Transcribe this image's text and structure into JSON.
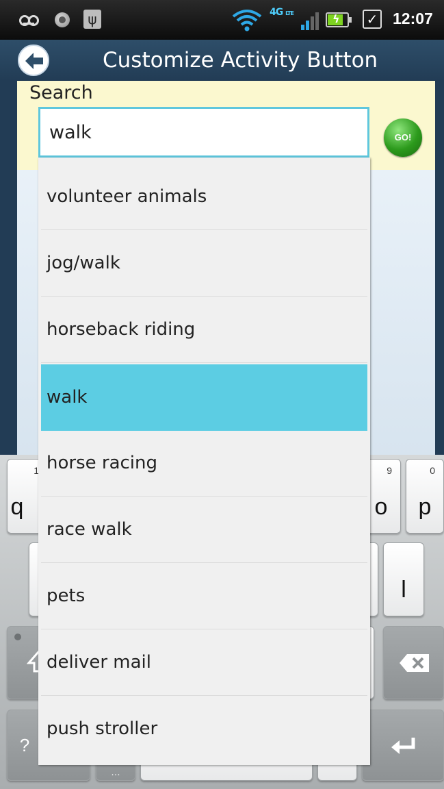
{
  "status_bar": {
    "time": "12:07",
    "network": "4G",
    "network_sub": "LTE",
    "icons": [
      "voicemail-icon",
      "record-icon",
      "usb-icon",
      "wifi-icon",
      "signal-icon",
      "battery-charging-icon",
      "checkbox-icon"
    ]
  },
  "header": {
    "title": "Customize Activity Button",
    "back_icon": "back-arrow-icon"
  },
  "search": {
    "label": "Search",
    "value": "walk",
    "go_label": "GO!"
  },
  "dropdown": {
    "selected_index": 3,
    "items": [
      "volunteer animals",
      "jog/walk",
      "horseback riding",
      "walk",
      "horse racing",
      "race walk",
      "pets",
      "deliver mail",
      "push stroller"
    ]
  },
  "keyboard": {
    "keys": {
      "q": {
        "label": "q",
        "hint": "1"
      },
      "o": {
        "label": "o",
        "hint": "9"
      },
      "p": {
        "label": "p",
        "hint": "0"
      },
      "l": {
        "label": "l"
      },
      "sym": {
        "label": "?"
      },
      "backspace_icon": "backspace-icon",
      "shift_icon": "shift-icon",
      "enter_icon": "enter-icon"
    }
  },
  "colors": {
    "title_bar": "#2e4e69",
    "search_area": "#fbf8cf",
    "highlight": "#5ccde3",
    "input_border": "#5fc7dd",
    "go_button": "#2c9a1c"
  }
}
